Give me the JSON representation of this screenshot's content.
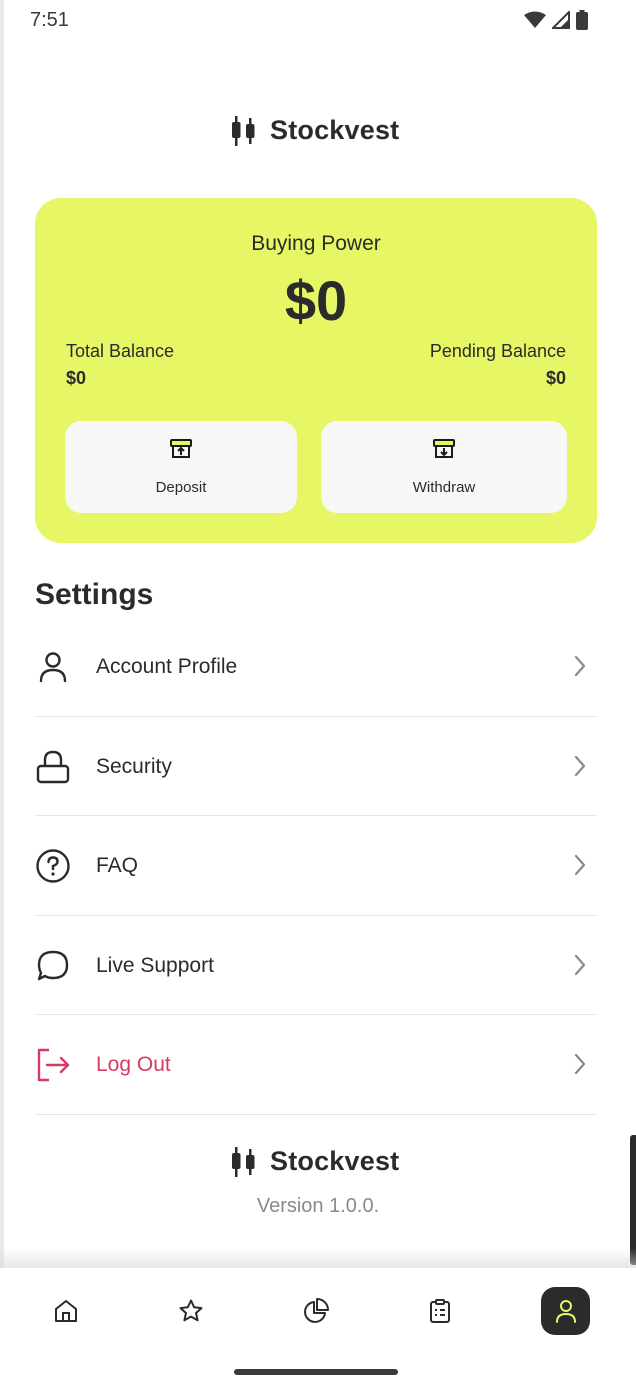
{
  "status_bar": {
    "time": "7:51",
    "icons": [
      "wifi-icon",
      "signal-icon",
      "battery-icon"
    ]
  },
  "brand": {
    "name_prefix": "Stockve",
    "name_highlight": "st",
    "accent_color": "#e6f664"
  },
  "balance": {
    "buying_power_label": "Buying Power",
    "buying_power_value": "$0",
    "total_balance_label": "Total Balance",
    "total_balance_value": "$0",
    "pending_balance_label": "Pending Balance",
    "pending_balance_value": "$0",
    "deposit_label": "Deposit",
    "withdraw_label": "Withdraw"
  },
  "settings": {
    "title": "Settings",
    "items": [
      {
        "label": "Account Profile",
        "icon": "user-icon"
      },
      {
        "label": "Security",
        "icon": "lock-icon"
      },
      {
        "label": "FAQ",
        "icon": "question-icon"
      },
      {
        "label": "Live Support",
        "icon": "chat-bubble-icon"
      },
      {
        "label": "Log Out",
        "icon": "logout-icon",
        "color": "#d93a64"
      }
    ]
  },
  "footer": {
    "version": "Version 1.0.0."
  },
  "tabs": [
    {
      "icon": "home-icon",
      "active": false
    },
    {
      "icon": "star-icon",
      "active": false
    },
    {
      "icon": "pie-chart-icon",
      "active": false
    },
    {
      "icon": "clipboard-icon",
      "active": false
    },
    {
      "icon": "user-icon",
      "active": true
    }
  ]
}
